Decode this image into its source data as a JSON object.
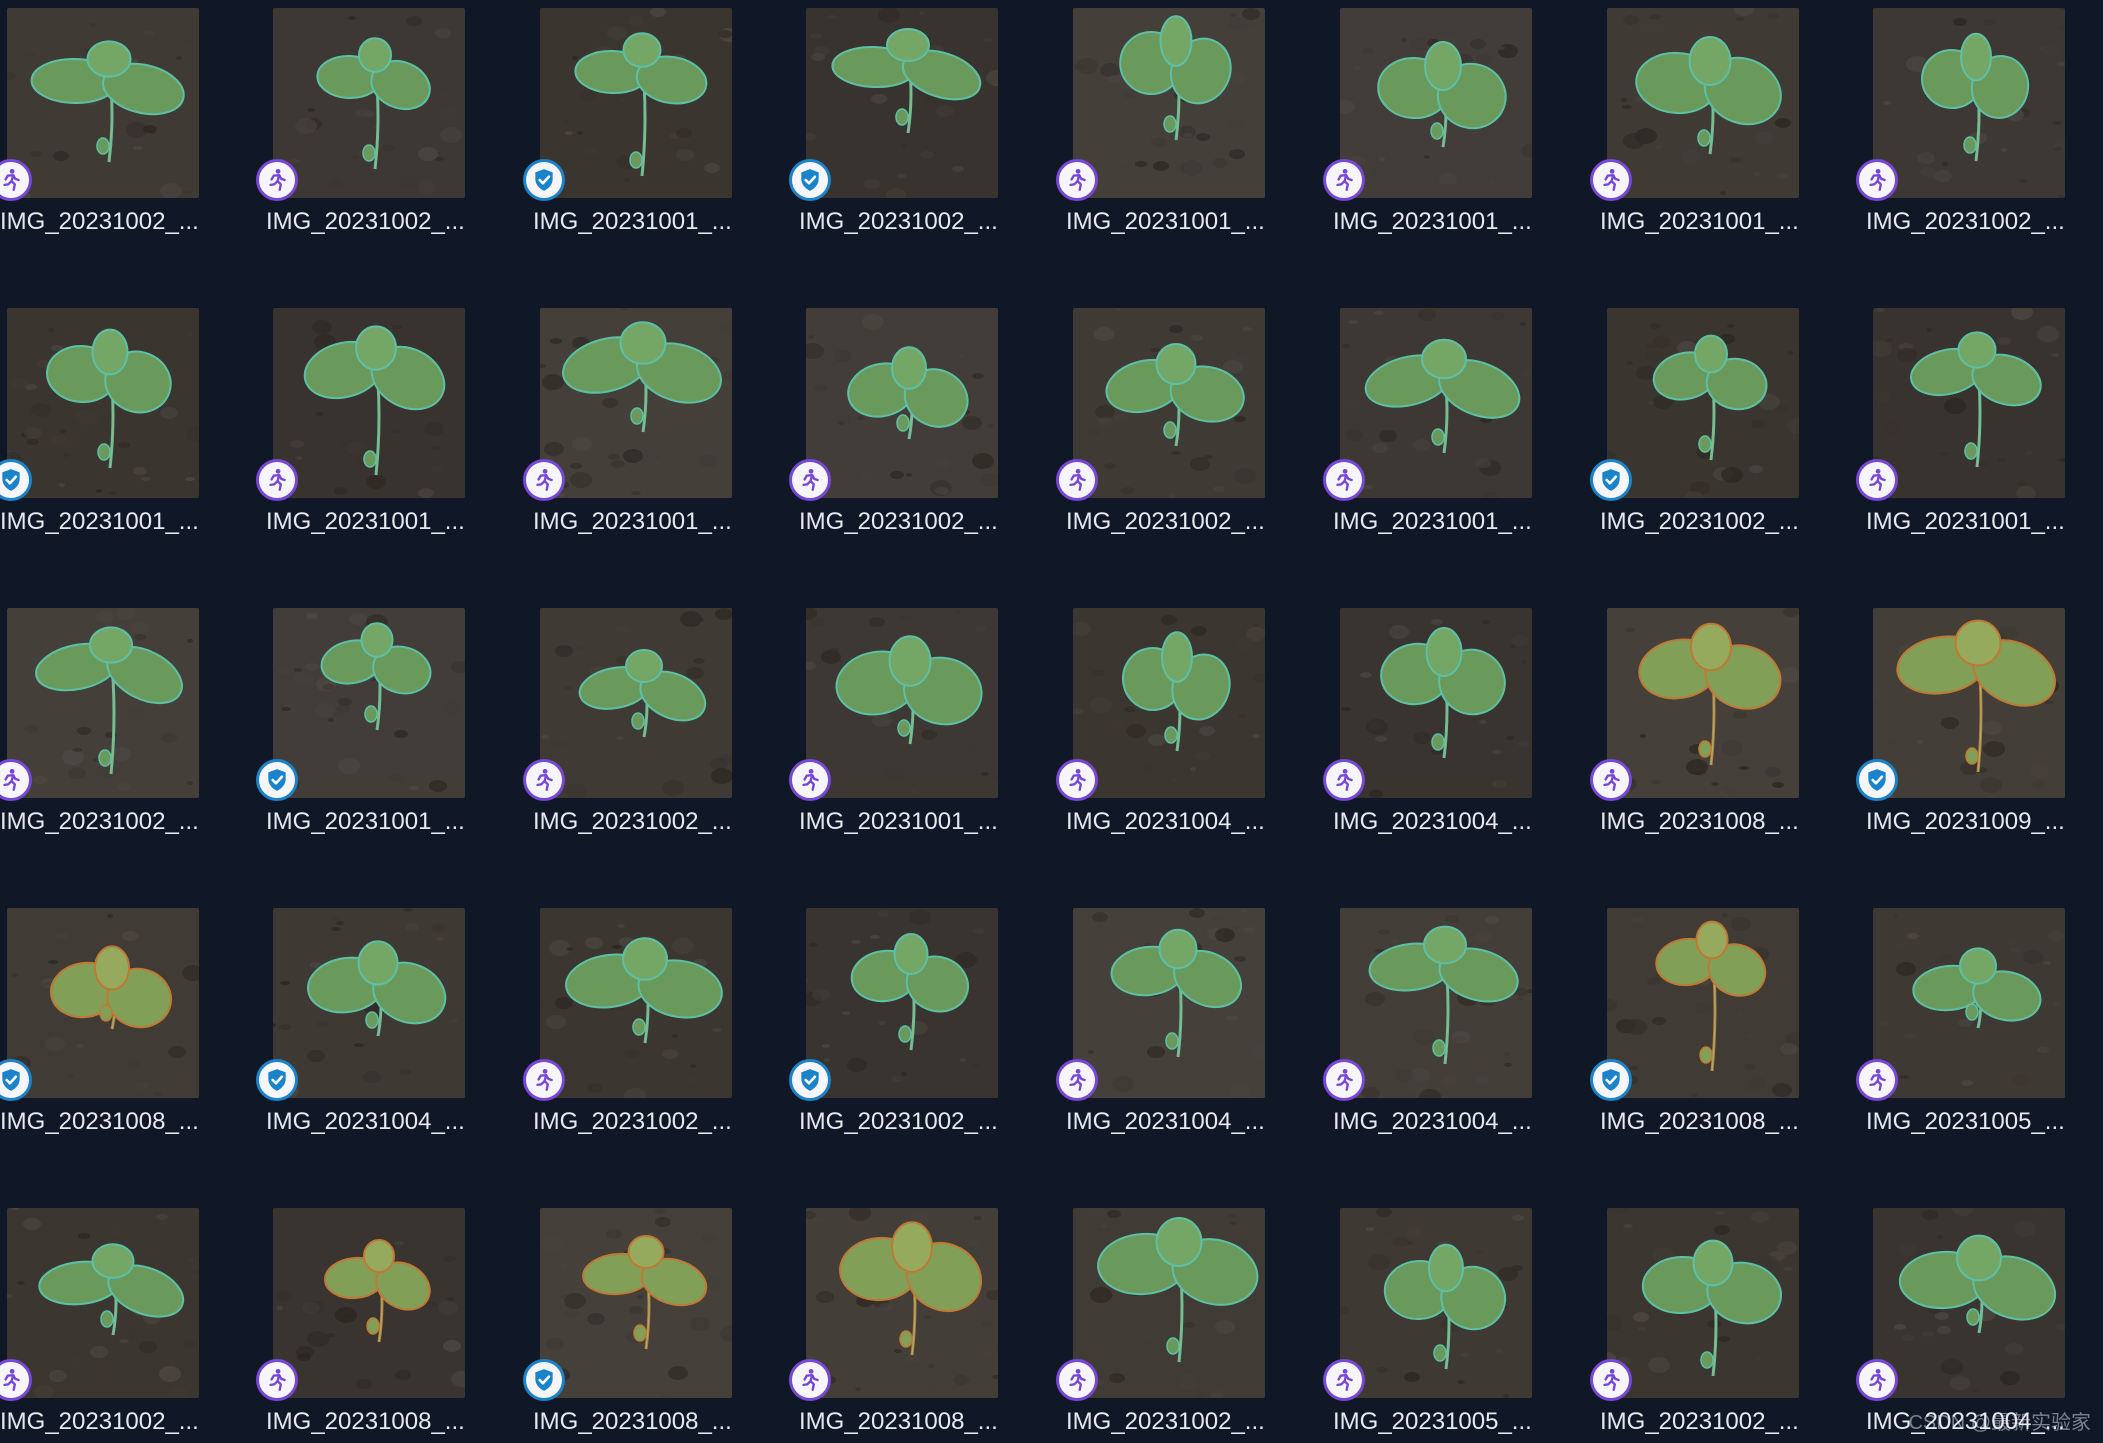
{
  "colors": {
    "background": "#101726",
    "sam_badge_ring": "#7747d6",
    "verified_badge_ring": "#1a83c9",
    "mask_outline_green": "#6ee7c4",
    "mask_outline_orange": "#e8903a",
    "soil": "#4a4034",
    "leaf": "#7fb86a"
  },
  "images": [
    {
      "name": "IMG_20231002_...",
      "status": "sam-icon"
    },
    {
      "name": "IMG_20231002_...",
      "status": "sam-icon"
    },
    {
      "name": "IMG_20231001_...",
      "status": "verified-icon"
    },
    {
      "name": "IMG_20231002_...",
      "status": "verified-icon"
    },
    {
      "name": "IMG_20231001_...",
      "status": "sam-icon"
    },
    {
      "name": "IMG_20231001_...",
      "status": "sam-icon"
    },
    {
      "name": "IMG_20231001_...",
      "status": "sam-icon"
    },
    {
      "name": "IMG_20231002_...",
      "status": "sam-icon"
    },
    {
      "name": "IMG_20231001_...",
      "status": "verified-icon"
    },
    {
      "name": "IMG_20231001_...",
      "status": "sam-icon"
    },
    {
      "name": "IMG_20231001_...",
      "status": "sam-icon"
    },
    {
      "name": "IMG_20231002_...",
      "status": "sam-icon"
    },
    {
      "name": "IMG_20231002_...",
      "status": "sam-icon"
    },
    {
      "name": "IMG_20231001_...",
      "status": "sam-icon"
    },
    {
      "name": "IMG_20231002_...",
      "status": "verified-icon"
    },
    {
      "name": "IMG_20231001_...",
      "status": "sam-icon"
    },
    {
      "name": "IMG_20231002_...",
      "status": "sam-icon"
    },
    {
      "name": "IMG_20231001_...",
      "status": "verified-icon"
    },
    {
      "name": "IMG_20231002_...",
      "status": "sam-icon"
    },
    {
      "name": "IMG_20231001_...",
      "status": "sam-icon"
    },
    {
      "name": "IMG_20231004_...",
      "status": "sam-icon"
    },
    {
      "name": "IMG_20231004_...",
      "status": "sam-icon"
    },
    {
      "name": "IMG_20231008_...",
      "status": "sam-icon"
    },
    {
      "name": "IMG_20231009_...",
      "status": "verified-icon"
    },
    {
      "name": "IMG_20231008_...",
      "status": "verified-icon"
    },
    {
      "name": "IMG_20231004_...",
      "status": "verified-icon"
    },
    {
      "name": "IMG_20231002_...",
      "status": "sam-icon"
    },
    {
      "name": "IMG_20231002_...",
      "status": "verified-icon"
    },
    {
      "name": "IMG_20231004_...",
      "status": "sam-icon"
    },
    {
      "name": "IMG_20231004_...",
      "status": "sam-icon"
    },
    {
      "name": "IMG_20231008_...",
      "status": "verified-icon"
    },
    {
      "name": "IMG_20231005_...",
      "status": "sam-icon"
    },
    {
      "name": "IMG_20231002_...",
      "status": "sam-icon"
    },
    {
      "name": "IMG_20231008_...",
      "status": "sam-icon"
    },
    {
      "name": "IMG_20231008_...",
      "status": "verified-icon"
    },
    {
      "name": "IMG_20231008_...",
      "status": "sam-icon"
    },
    {
      "name": "IMG_20231002_...",
      "status": "sam-icon"
    },
    {
      "name": "IMG_20231005_...",
      "status": "sam-icon"
    },
    {
      "name": "IMG_20231002_...",
      "status": "sam-icon"
    },
    {
      "name": "IMG_20231004_...",
      "status": "sam-icon"
    }
  ],
  "watermark": "CSDN @最新实验家"
}
